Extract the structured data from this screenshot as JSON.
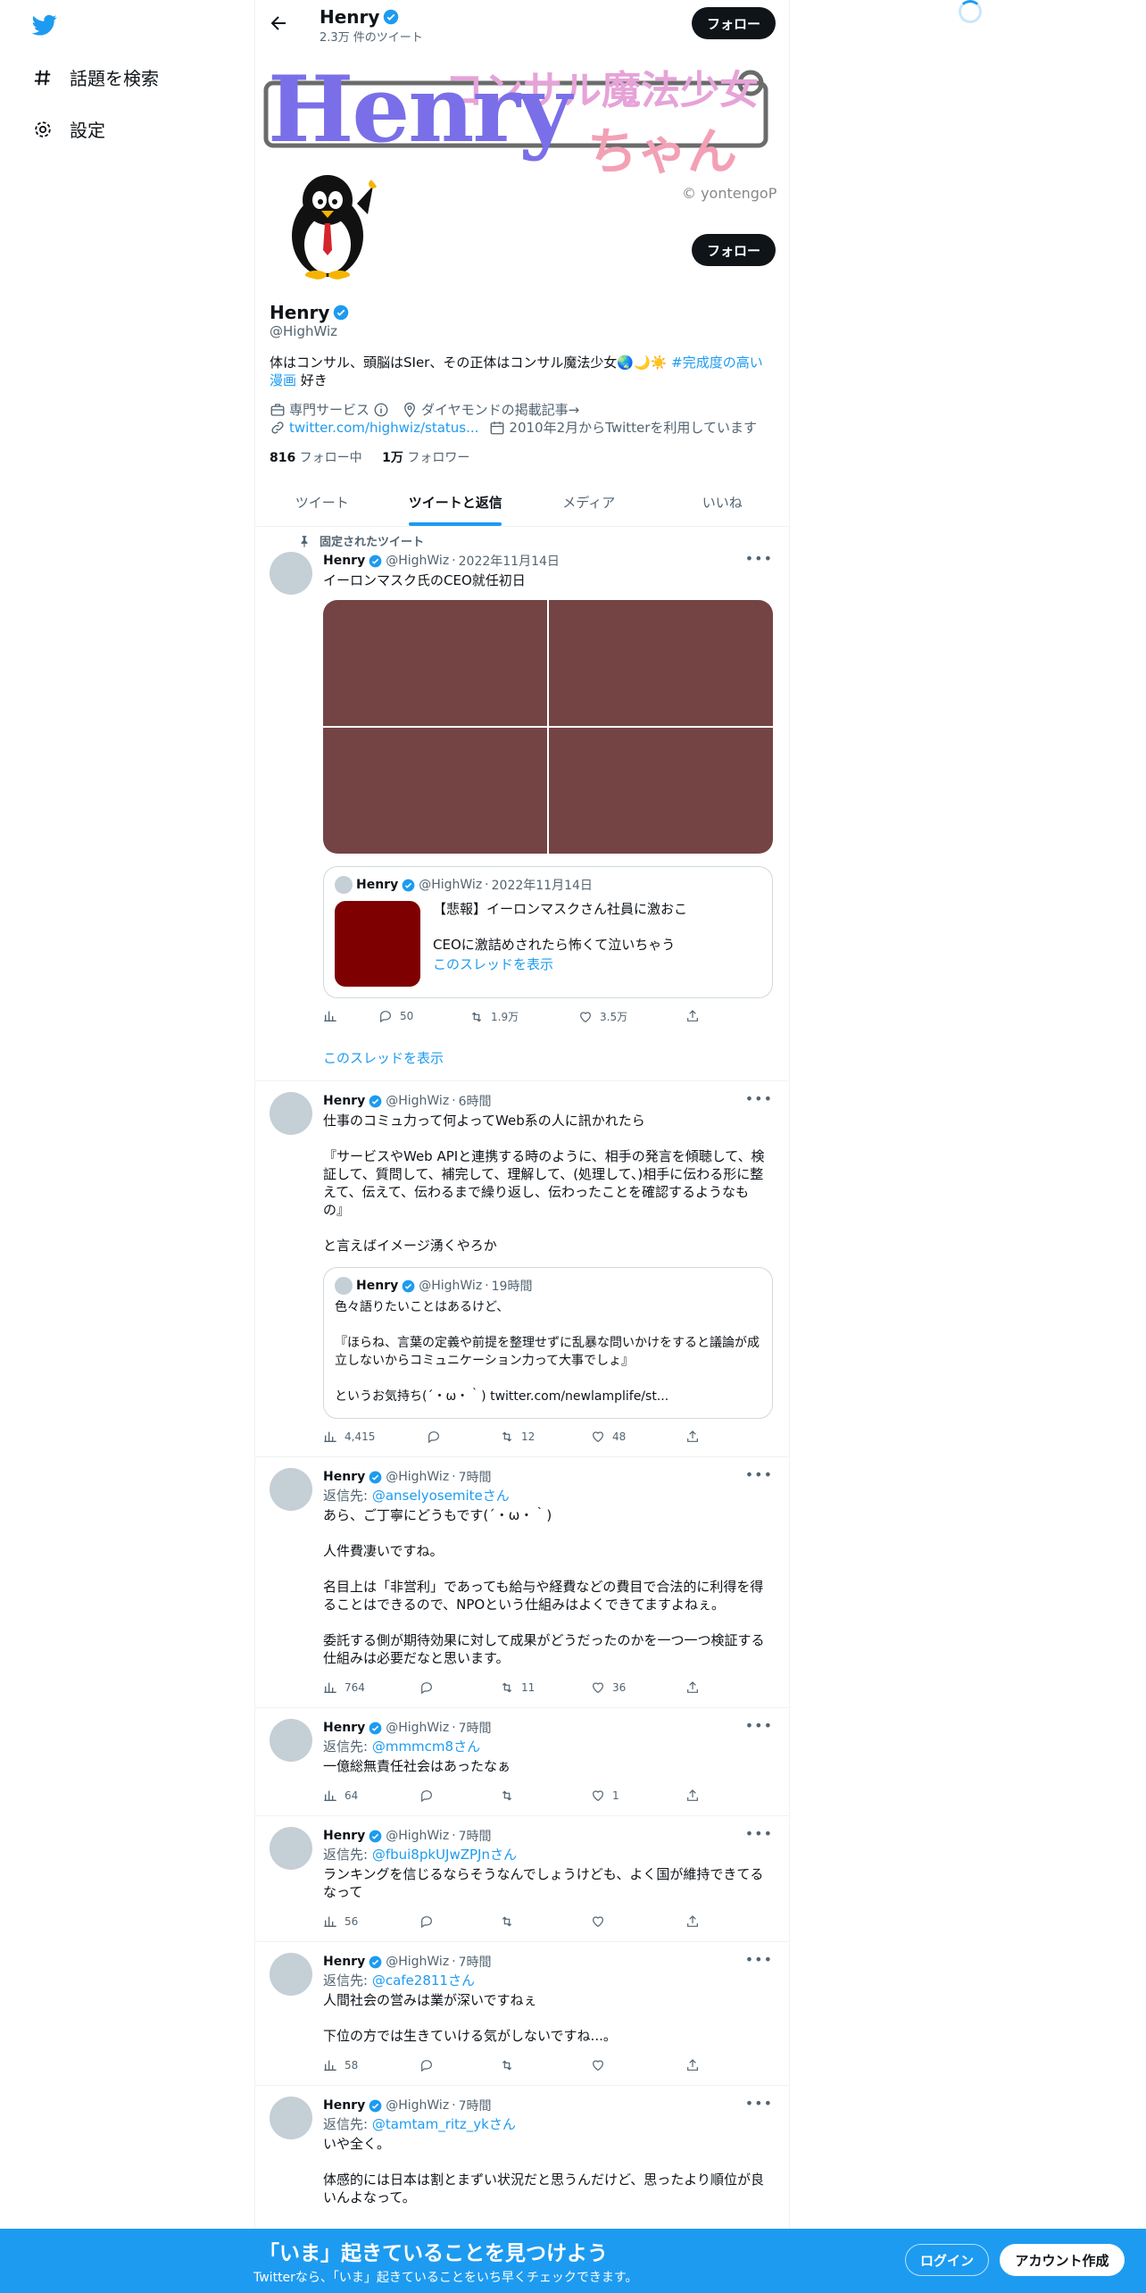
{
  "sidebar": {
    "items": [
      {
        "label": "話題を検索",
        "icon": "hashtag-icon"
      },
      {
        "label": "設定",
        "icon": "gear-icon"
      }
    ]
  },
  "header": {
    "name": "Henry",
    "tweet_count": "2.3万 件のツイート",
    "follow_label": "フォロー"
  },
  "banner": {
    "title_jp": "コンサル魔法少女",
    "title_en": "Henry",
    "title_chan": "ちゃん",
    "credit": "© yontengoP"
  },
  "profile": {
    "name": "Henry",
    "handle": "@HighWiz",
    "follow_label": "フォロー",
    "bio_text": "体はコンサル、頭脳はSIer、その正体はコンサル魔法少女🌏🌙☀️ ",
    "bio_hashtag": "#完成度の高い漫画",
    "bio_tail": " 好き",
    "category": "専門サービス",
    "location": "ダイヤモンドの掲載記事→",
    "link": "twitter.com/highwiz/status...",
    "joined": "2010年2月からTwitterを利用しています",
    "following_count": "816",
    "following_label": " フォロー中",
    "followers_count": "1万",
    "followers_label": " フォロワー"
  },
  "tabs": [
    "ツイート",
    "ツイートと返信",
    "メディア",
    "いいね"
  ],
  "colors": {
    "accent": "#1d9bf0",
    "text": "#0f1419",
    "muted": "#536471",
    "media": "#744444",
    "quote_thumb": "#7f0000"
  },
  "tweets": [
    {
      "pinned_label": "固定されたツイート",
      "name": "Henry",
      "handle": "@HighWiz",
      "time": "2022年11月14日",
      "text": "イーロンマスク氏のCEO就任初日",
      "quote": {
        "name": "Henry",
        "handle": "@HighWiz",
        "time": "2022年11月14日",
        "line1": "【悲報】イーロンマスクさん社員に激おこ",
        "line2": "CEOに激詰めされたら怖くて泣いちゃう",
        "thread": "このスレッドを表示"
      },
      "views": "",
      "replies": "50",
      "retweets": "1.9万",
      "likes": "3.5万",
      "show_thread": "このスレッドを表示"
    },
    {
      "name": "Henry",
      "handle": "@HighWiz",
      "time": "6時間",
      "text": "仕事のコミュ力って何よってWeb系の人に訊かれたら\n\n『サービスやWeb APIと連携する時のように、相手の発言を傾聴して、検証して、質問して、補完して、理解して、(処理して、)相手に伝わる形に整えて、伝えて、伝わるまで繰り返し、伝わったことを確認するようなもの』\n\nと言えばイメージ湧くやろか",
      "quote": {
        "name": "Henry",
        "handle": "@HighWiz",
        "time": "19時間",
        "text": "色々語りたいことはあるけど、\n\n『ほらね、言葉の定義や前提を整理せずに乱暴な問いかけをすると議論が成立しないからコミュニケーション力って大事でしょ』\n\nというお気持ち(´・ω・｀) twitter.com/newlamplife/st..."
      },
      "views": "4,415",
      "replies": "",
      "retweets": "12",
      "likes": "48"
    },
    {
      "name": "Henry",
      "handle": "@HighWiz",
      "time": "7時間",
      "reply_prefix": "返信先: ",
      "reply_to": "@anselyosemite",
      "reply_suffix": "さん",
      "text": "あら、ご丁寧にどうもです(´・ω・｀)\n\n人件費凄いですね。\n\n名目上は「非営利」であっても給与や経費などの費目で合法的に利得を得ることはできるので、NPOという仕組みはよくできてますよねぇ。\n\n委託する側が期待効果に対して成果がどうだったのかを一つ一つ検証する仕組みは必要だなと思います。",
      "views": "764",
      "replies": "",
      "retweets": "11",
      "likes": "36"
    },
    {
      "name": "Henry",
      "handle": "@HighWiz",
      "time": "7時間",
      "reply_prefix": "返信先: ",
      "reply_to": "@mmmcm8",
      "reply_suffix": "さん",
      "text": "一億総無責任社会はあったなぁ",
      "views": "64",
      "replies": "",
      "retweets": "",
      "likes": "1"
    },
    {
      "name": "Henry",
      "handle": "@HighWiz",
      "time": "7時間",
      "reply_prefix": "返信先: ",
      "reply_to": "@fbui8pkUJwZPJn",
      "reply_suffix": "さん",
      "text": "ランキングを信じるならそうなんでしょうけども、よく国が維持できてるなって",
      "views": "56",
      "replies": "",
      "retweets": "",
      "likes": ""
    },
    {
      "name": "Henry",
      "handle": "@HighWiz",
      "time": "7時間",
      "reply_prefix": "返信先: ",
      "reply_to": "@cafe2811",
      "reply_suffix": "さん",
      "text": "人間社会の営みは業が深いですねぇ\n\n下位の方では生きていける気がしないですね...。",
      "views": "58",
      "replies": "",
      "retweets": "",
      "likes": ""
    },
    {
      "name": "Henry",
      "handle": "@HighWiz",
      "time": "7時間",
      "reply_prefix": "返信先: ",
      "reply_to": "@tamtam_ritz_yk",
      "reply_suffix": "さん",
      "text": "いや全く。\n\n体感的には日本は割とまずい状況だと思うんだけど、思ったより順位が良いんよなって。"
    }
  ],
  "bottom_bar": {
    "title": "「いま」起きていることを見つけよう",
    "subtitle": "Twitterなら、「いま」起きていることをいち早くチェックできます。",
    "login": "ログイン",
    "signup": "アカウント作成"
  }
}
